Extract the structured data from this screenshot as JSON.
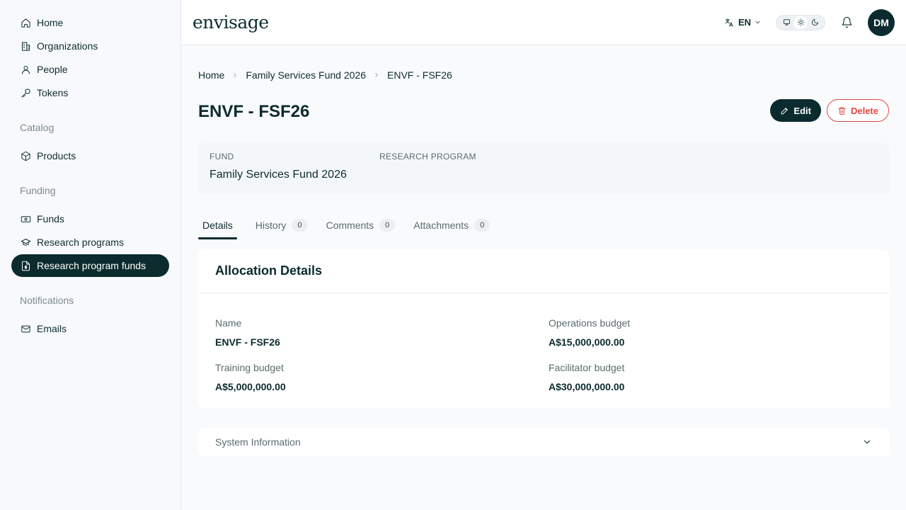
{
  "sidebar": {
    "items": [
      {
        "label": "Home",
        "icon": "home-icon"
      },
      {
        "label": "Organizations",
        "icon": "building-icon"
      },
      {
        "label": "People",
        "icon": "person-icon"
      },
      {
        "label": "Tokens",
        "icon": "key-icon"
      }
    ],
    "catalog_label": "Catalog",
    "catalog_items": [
      {
        "label": "Products",
        "icon": "box-icon"
      }
    ],
    "funding_label": "Funding",
    "funding_items": [
      {
        "label": "Funds",
        "icon": "banknote-icon"
      },
      {
        "label": "Research programs",
        "icon": "graduation-cap-icon"
      },
      {
        "label": "Research program funds",
        "icon": "file-dollar-icon",
        "active": true
      }
    ],
    "notifications_label": "Notifications",
    "notifications_items": [
      {
        "label": "Emails",
        "icon": "mail-icon"
      }
    ]
  },
  "header": {
    "logo": "envisage",
    "language": "EN",
    "avatar_initials": "DM",
    "theme_mode": "light"
  },
  "breadcrumb": [
    "Home",
    "Family Services Fund 2026",
    "ENVF - FSF26"
  ],
  "page": {
    "title": "ENVF - FSF26",
    "edit_label": "Edit",
    "delete_label": "Delete"
  },
  "summary": {
    "fund_label": "FUND",
    "fund_value": "Family Services Fund 2026",
    "program_label": "RESEARCH PROGRAM",
    "program_value": ""
  },
  "tabs": [
    {
      "label": "Details",
      "active": true
    },
    {
      "label": "History",
      "count": "0"
    },
    {
      "label": "Comments",
      "count": "0"
    },
    {
      "label": "Attachments",
      "count": "0"
    }
  ],
  "allocation": {
    "title": "Allocation Details",
    "fields": [
      {
        "label": "Name",
        "value": "ENVF - FSF26"
      },
      {
        "label": "Operations budget",
        "value": "A$15,000,000.00"
      },
      {
        "label": "Training budget",
        "value": "A$5,000,000.00"
      },
      {
        "label": "Facilitator budget",
        "value": "A$30,000,000.00"
      }
    ]
  },
  "system_info": {
    "label": "System Information"
  },
  "colors": {
    "primary": "#0c2b2e",
    "danger": "#e0483f",
    "background": "#f8fafc"
  }
}
